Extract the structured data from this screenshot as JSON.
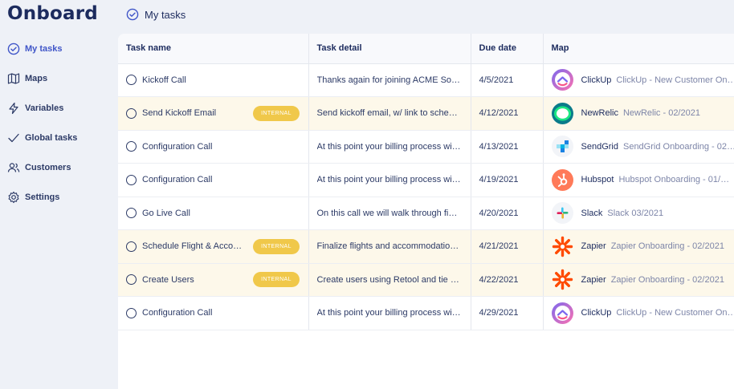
{
  "app": {
    "logo": "Onboard"
  },
  "header": {
    "title": "My tasks"
  },
  "sidebar": {
    "items": [
      {
        "label": "My tasks",
        "icon": "check-circle-icon",
        "active": true
      },
      {
        "label": "Maps",
        "icon": "map-icon"
      },
      {
        "label": "Variables",
        "icon": "lightning-icon"
      },
      {
        "label": "Global tasks",
        "icon": "checkmark-icon"
      },
      {
        "label": "Customers",
        "icon": "users-icon"
      },
      {
        "label": "Settings",
        "icon": "gear-icon"
      }
    ]
  },
  "table": {
    "columns": [
      "Task name",
      "Task detail",
      "Due date",
      "Map"
    ],
    "rows": [
      {
        "task": "Kickoff Call",
        "badge": "",
        "detail": "Thanks again for joining ACME Soft…",
        "due": "4/5/2021",
        "app": "ClickUp",
        "map": "ClickUp - New Customer On…",
        "icon": "clickup-icon"
      },
      {
        "task": "Send Kickoff Email",
        "badge": "INTERNAL",
        "detail": "Send kickoff email, w/ link to schedu…",
        "due": "4/12/2021",
        "app": "NewRelic",
        "map": "NewRelic - 02/2021",
        "icon": "newrelic-icon"
      },
      {
        "task": "Configuration Call",
        "badge": "",
        "detail": "At this point your billing process will …",
        "due": "4/13/2021",
        "app": "SendGrid",
        "map": "SendGrid Onboarding - 02…",
        "icon": "sendgrid-icon"
      },
      {
        "task": "Configuration Call",
        "badge": "",
        "detail": "At this point your billing process will …",
        "due": "4/19/2021",
        "app": "Hubspot",
        "map": "Hubspot Onboarding - 01/…",
        "icon": "hubspot-icon"
      },
      {
        "task": "Go Live Call",
        "badge": "",
        "detail": "On this call we will walk through fina…",
        "due": "4/20/2021",
        "app": "Slack",
        "map": "Slack 03/2021",
        "icon": "slack-icon"
      },
      {
        "task": "Schedule Flight & Accom…",
        "badge": "INTERNAL",
        "detail": "Finalize flights and accommodation…",
        "due": "4/21/2021",
        "app": "Zapier",
        "map": "Zapier Onboarding - 02/2021",
        "icon": "zapier-icon"
      },
      {
        "task": "Create Users",
        "badge": "INTERNAL",
        "detail": "Create users using Retool and tie th…",
        "due": "4/22/2021",
        "app": "Zapier",
        "map": "Zapier Onboarding - 02/2021",
        "icon": "zapier-icon"
      },
      {
        "task": "Configuration Call",
        "badge": "",
        "detail": "At this point your billing process will …",
        "due": "4/29/2021",
        "app": "ClickUp",
        "map": "ClickUp - New Customer On…",
        "icon": "clickup-icon"
      }
    ]
  },
  "colors": {
    "brand": "#1c2b5e",
    "active": "#3f55c8",
    "internal_badge": "#f0c84a",
    "internal_row": "#fdf8ea"
  }
}
